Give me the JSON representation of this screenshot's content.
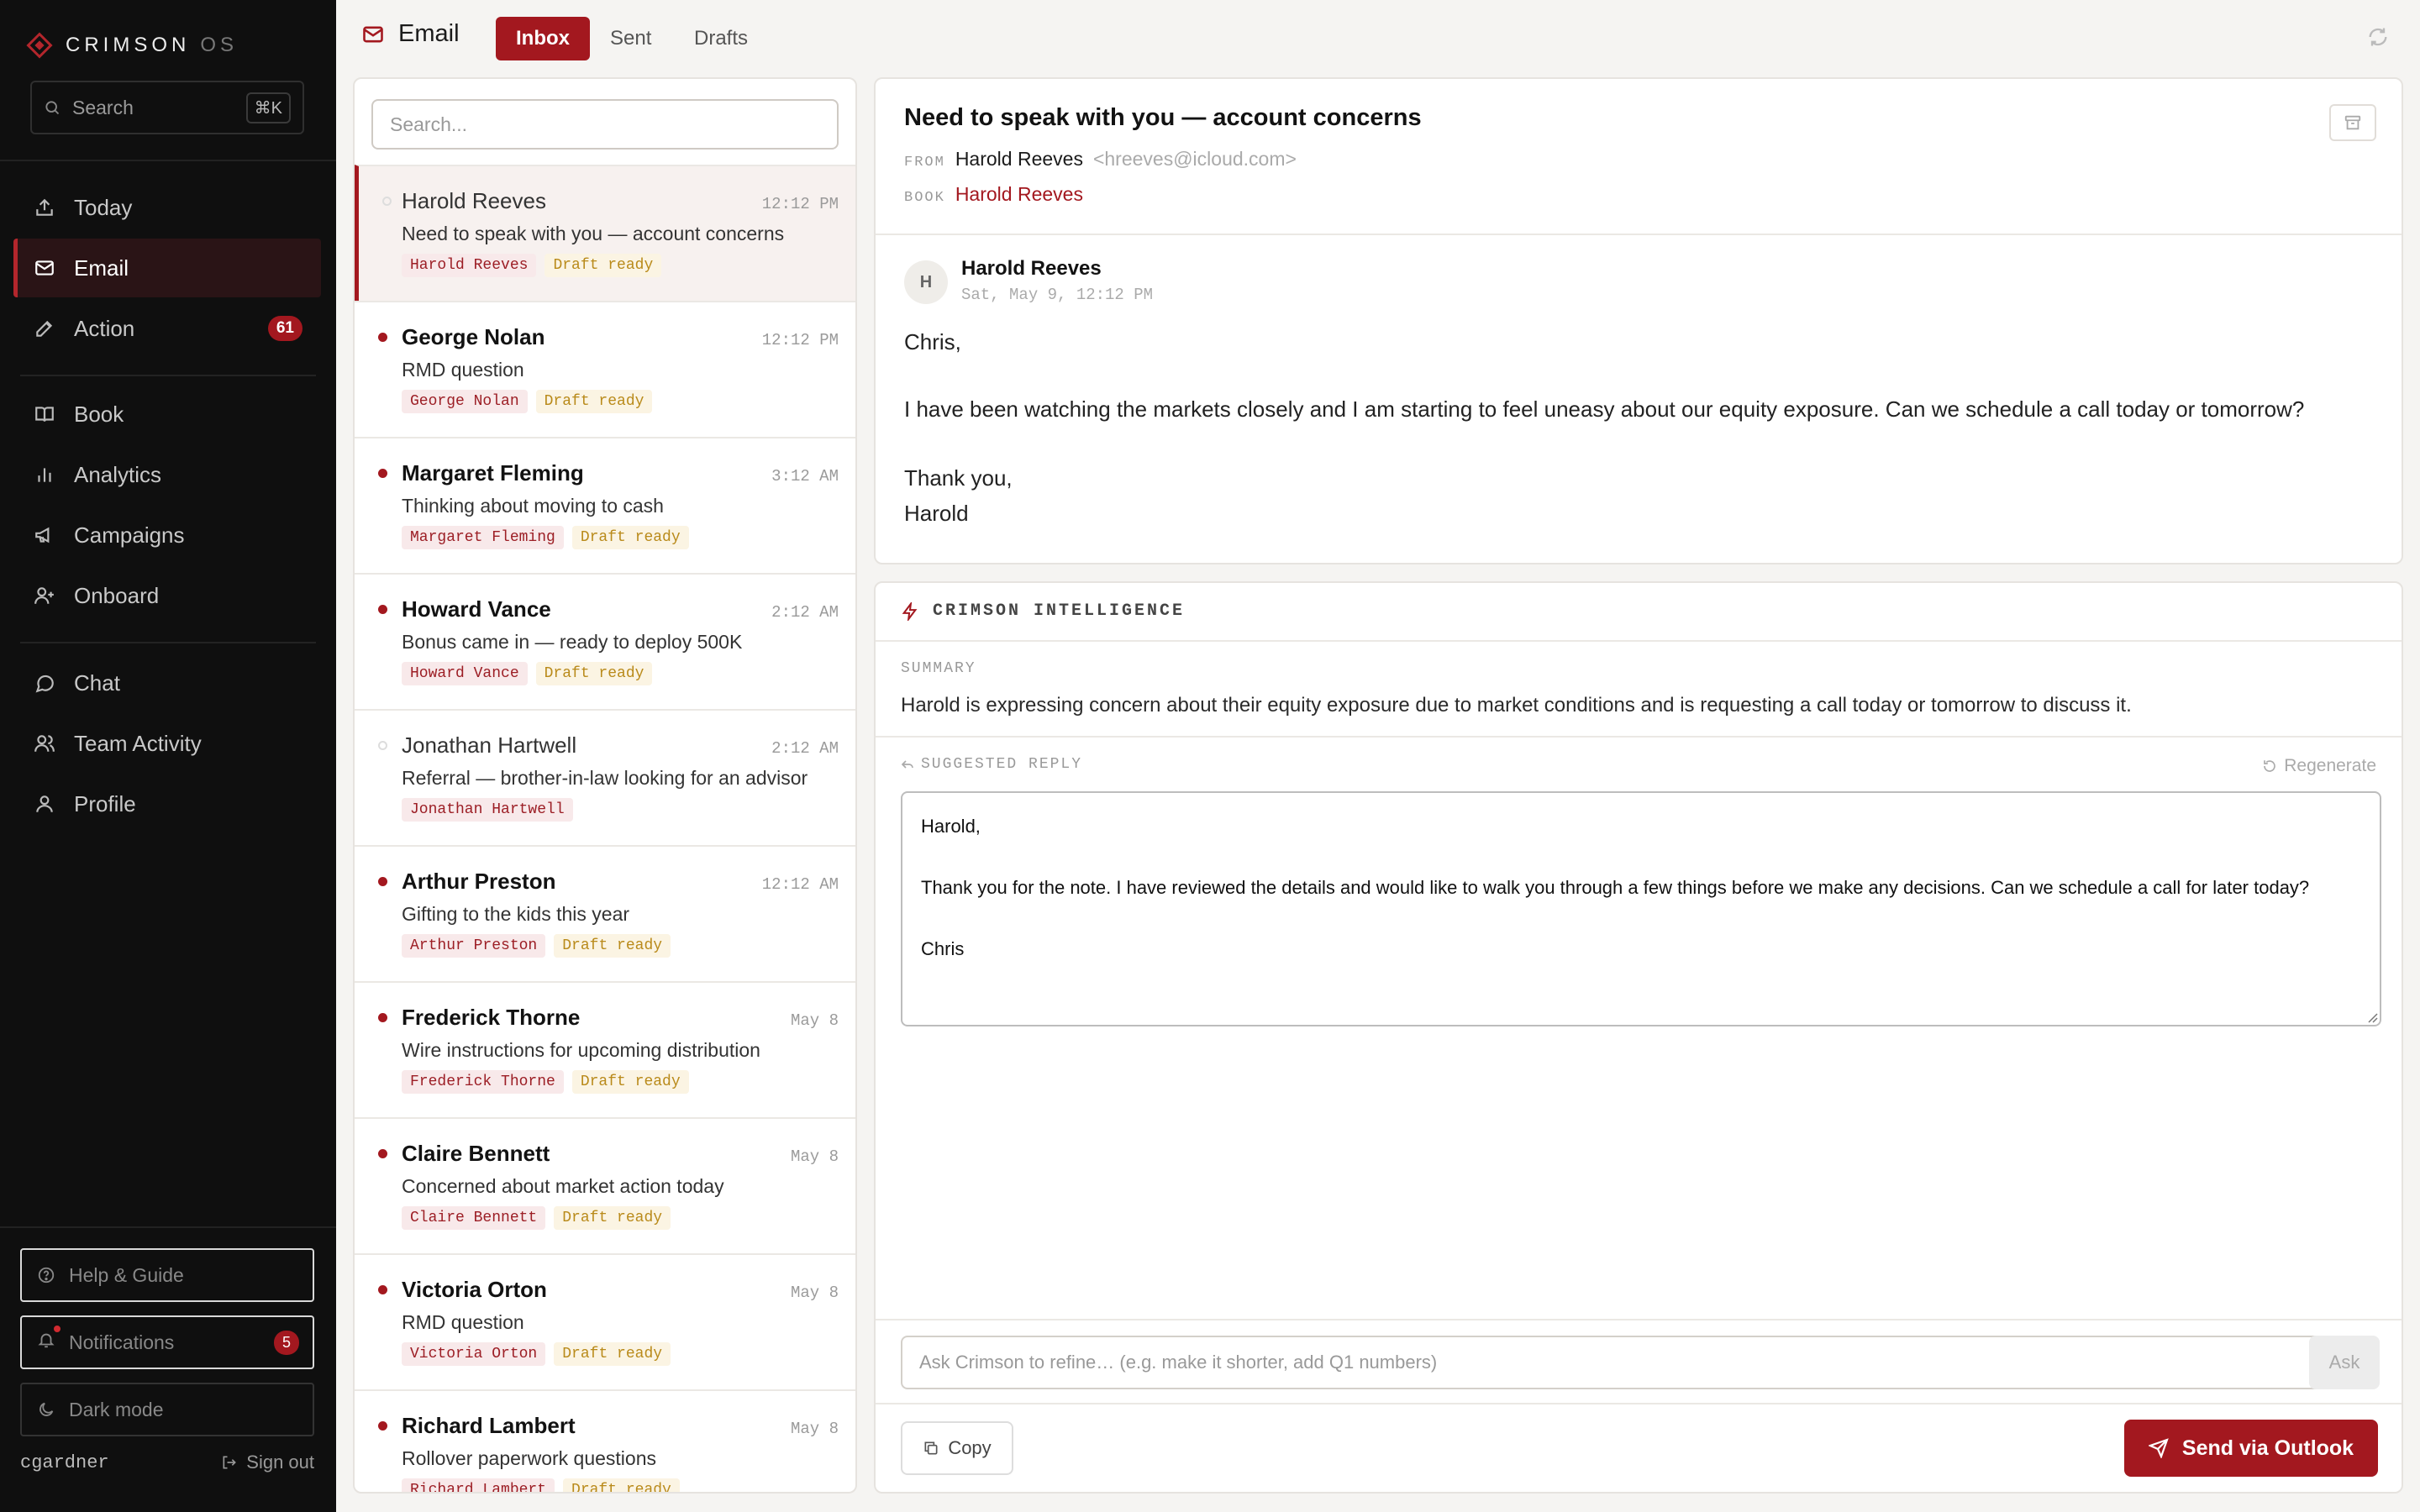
{
  "sidebar": {
    "brand": "CRIMSON",
    "brand_suffix": "OS",
    "search_placeholder": "Search",
    "search_shortcut": "⌘K",
    "nav": [
      {
        "label": "Today",
        "icon": "upload-tray-icon"
      },
      {
        "label": "Email",
        "icon": "mail-icon",
        "active": true
      },
      {
        "label": "Action",
        "icon": "pencil-icon",
        "badge": "61"
      },
      {
        "label": "Book",
        "icon": "book-icon"
      },
      {
        "label": "Analytics",
        "icon": "bar-chart-icon"
      },
      {
        "label": "Campaigns",
        "icon": "megaphone-icon"
      },
      {
        "label": "Onboard",
        "icon": "user-plus-icon"
      },
      {
        "label": "Chat",
        "icon": "chat-bubble-icon"
      },
      {
        "label": "Team Activity",
        "icon": "users-icon"
      },
      {
        "label": "Profile",
        "icon": "user-icon"
      }
    ],
    "help_label": "Help & Guide",
    "notifications_label": "Notifications",
    "notifications_count": "5",
    "dark_mode_label": "Dark mode",
    "username": "cgardner",
    "signout_label": "Sign out"
  },
  "topbar": {
    "title": "Email",
    "tabs": [
      "Inbox",
      "Sent",
      "Drafts"
    ],
    "active_tab": "Inbox"
  },
  "list": {
    "search_placeholder": "Search...",
    "emails": [
      {
        "sender": "Harold Reeves",
        "time": "12:12 PM",
        "subject": "Need to speak with you — account concerns",
        "tag": "Harold Reeves",
        "draft": "Draft ready",
        "unread": false,
        "selected": true
      },
      {
        "sender": "George Nolan",
        "time": "12:12 PM",
        "subject": "RMD question",
        "tag": "George Nolan",
        "draft": "Draft ready",
        "unread": true
      },
      {
        "sender": "Margaret Fleming",
        "time": "3:12 AM",
        "subject": "Thinking about moving to cash",
        "tag": "Margaret Fleming",
        "draft": "Draft ready",
        "unread": true
      },
      {
        "sender": "Howard Vance",
        "time": "2:12 AM",
        "subject": "Bonus came in — ready to deploy 500K",
        "tag": "Howard Vance",
        "draft": "Draft ready",
        "unread": true
      },
      {
        "sender": "Jonathan Hartwell",
        "time": "2:12 AM",
        "subject": "Referral — brother-in-law looking for an advisor",
        "tag": "Jonathan Hartwell",
        "draft": "",
        "unread": false
      },
      {
        "sender": "Arthur Preston",
        "time": "12:12 AM",
        "subject": "Gifting to the kids this year",
        "tag": "Arthur Preston",
        "draft": "Draft ready",
        "unread": true
      },
      {
        "sender": "Frederick Thorne",
        "time": "May 8",
        "subject": "Wire instructions for upcoming distribution",
        "tag": "Frederick Thorne",
        "draft": "Draft ready",
        "unread": true
      },
      {
        "sender": "Claire Bennett",
        "time": "May 8",
        "subject": "Concerned about market action today",
        "tag": "Claire Bennett",
        "draft": "Draft ready",
        "unread": true
      },
      {
        "sender": "Victoria Orton",
        "time": "May 8",
        "subject": "RMD question",
        "tag": "Victoria Orton",
        "draft": "Draft ready",
        "unread": true
      },
      {
        "sender": "Richard Lambert",
        "time": "May 8",
        "subject": "Rollover paperwork questions",
        "tag": "Richard Lambert",
        "draft": "Draft ready",
        "unread": true
      }
    ]
  },
  "message": {
    "subject": "Need to speak with you — account concerns",
    "from_label": "FROM",
    "from_name": "Harold Reeves",
    "from_email": "<hreeves@icloud.com>",
    "book_label": "BOOK",
    "book_link": "Harold Reeves",
    "avatar_initial": "H",
    "sender_name": "Harold Reeves",
    "date": "Sat, May 9, 12:12 PM",
    "greeting": "Chris,",
    "body": "I have been watching the markets closely and I am starting to feel uneasy about our equity exposure. Can we schedule a call today or tomorrow?",
    "closing": "Thank you,",
    "signature": "Harold"
  },
  "intelligence": {
    "title": "CRIMSON INTELLIGENCE",
    "summary_label": "SUMMARY",
    "summary": "Harold is expressing concern about their equity exposure due to market conditions and is requesting a call today or tomorrow to discuss it.",
    "reply_label": "SUGGESTED REPLY",
    "regenerate_label": "Regenerate",
    "reply_text": "Harold,\n\nThank you for the note. I have reviewed the details and would like to walk you through a few things before we make any decisions. Can we schedule a call for later today?\n\nChris",
    "ask_placeholder": "Ask Crimson to refine… (e.g. make it shorter, add Q1 numbers)",
    "ask_label": "Ask",
    "copy_label": "Copy",
    "send_label": "Send via Outlook"
  },
  "colors": {
    "accent": "#a3181f",
    "sidebar_bg": "#0f0f0f",
    "draft_tag": "#b98a1a"
  }
}
